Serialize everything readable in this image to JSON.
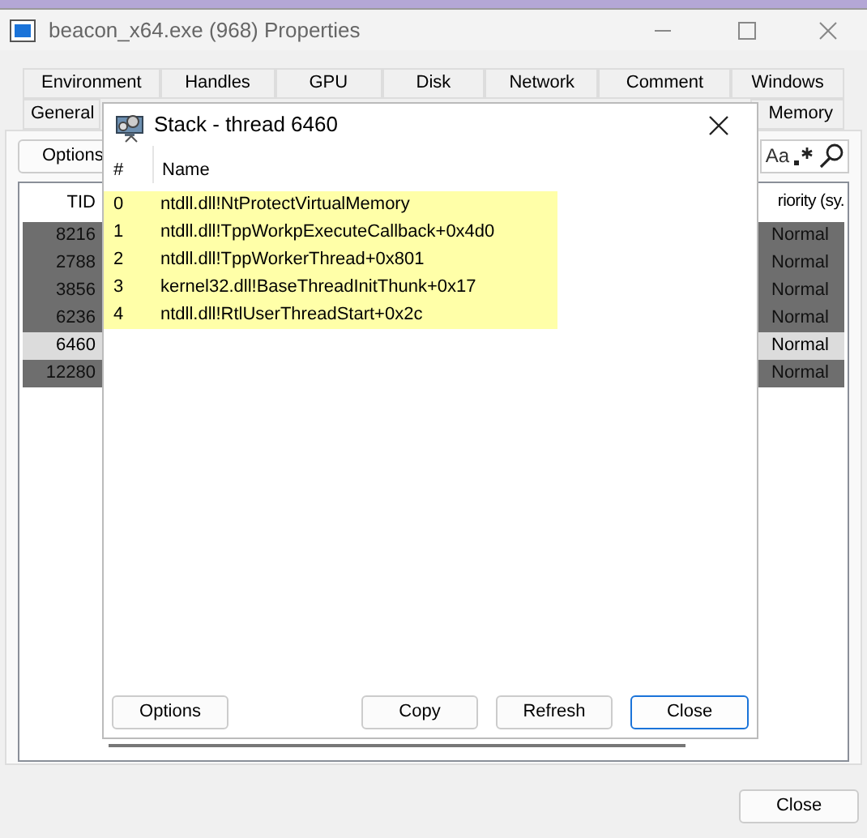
{
  "window": {
    "title": "beacon_x64.exe (968) Properties"
  },
  "tabs_row_1": [
    {
      "label": "Environment",
      "selected": false
    },
    {
      "label": "Handles",
      "selected": false
    },
    {
      "label": "GPU",
      "selected": false
    },
    {
      "label": "Disk",
      "selected": false
    },
    {
      "label": "Network",
      "selected": false
    },
    {
      "label": "Comment",
      "selected": false
    },
    {
      "label": "Windows",
      "selected": false
    }
  ],
  "tabs_row_2": [
    {
      "label": "General",
      "selected": false
    },
    {
      "label": "Memory",
      "selected": false
    }
  ],
  "toolbar": {
    "options_button": "Options",
    "case_toggle": "Aa"
  },
  "threads": {
    "columns": [
      "TID",
      "riority (sy."
    ],
    "rows": [
      {
        "tid": "8216",
        "priority": "Normal",
        "selected": false
      },
      {
        "tid": "2788",
        "priority": "Normal",
        "selected": false
      },
      {
        "tid": "3856",
        "priority": "Normal",
        "selected": false
      },
      {
        "tid": "6236",
        "priority": "Normal",
        "selected": false
      },
      {
        "tid": "6460",
        "priority": "Normal",
        "selected": true
      },
      {
        "tid": "12280",
        "priority": "Normal",
        "selected": false
      }
    ]
  },
  "close_button": "Close",
  "stack_dialog": {
    "title": "Stack - thread 6460",
    "columns": [
      "#",
      "Name"
    ],
    "frames": [
      {
        "index": "0",
        "name": "ntdll.dll!NtProtectVirtualMemory"
      },
      {
        "index": "1",
        "name": "ntdll.dll!TppWorkpExecuteCallback+0x4d0"
      },
      {
        "index": "2",
        "name": "ntdll.dll!TppWorkerThread+0x801"
      },
      {
        "index": "3",
        "name": "kernel32.dll!BaseThreadInitThunk+0x17"
      },
      {
        "index": "4",
        "name": "ntdll.dll!RtlUserThreadStart+0x2c"
      }
    ],
    "buttons": {
      "options": "Options",
      "copy": "Copy",
      "refresh": "Refresh",
      "close": "Close"
    }
  }
}
